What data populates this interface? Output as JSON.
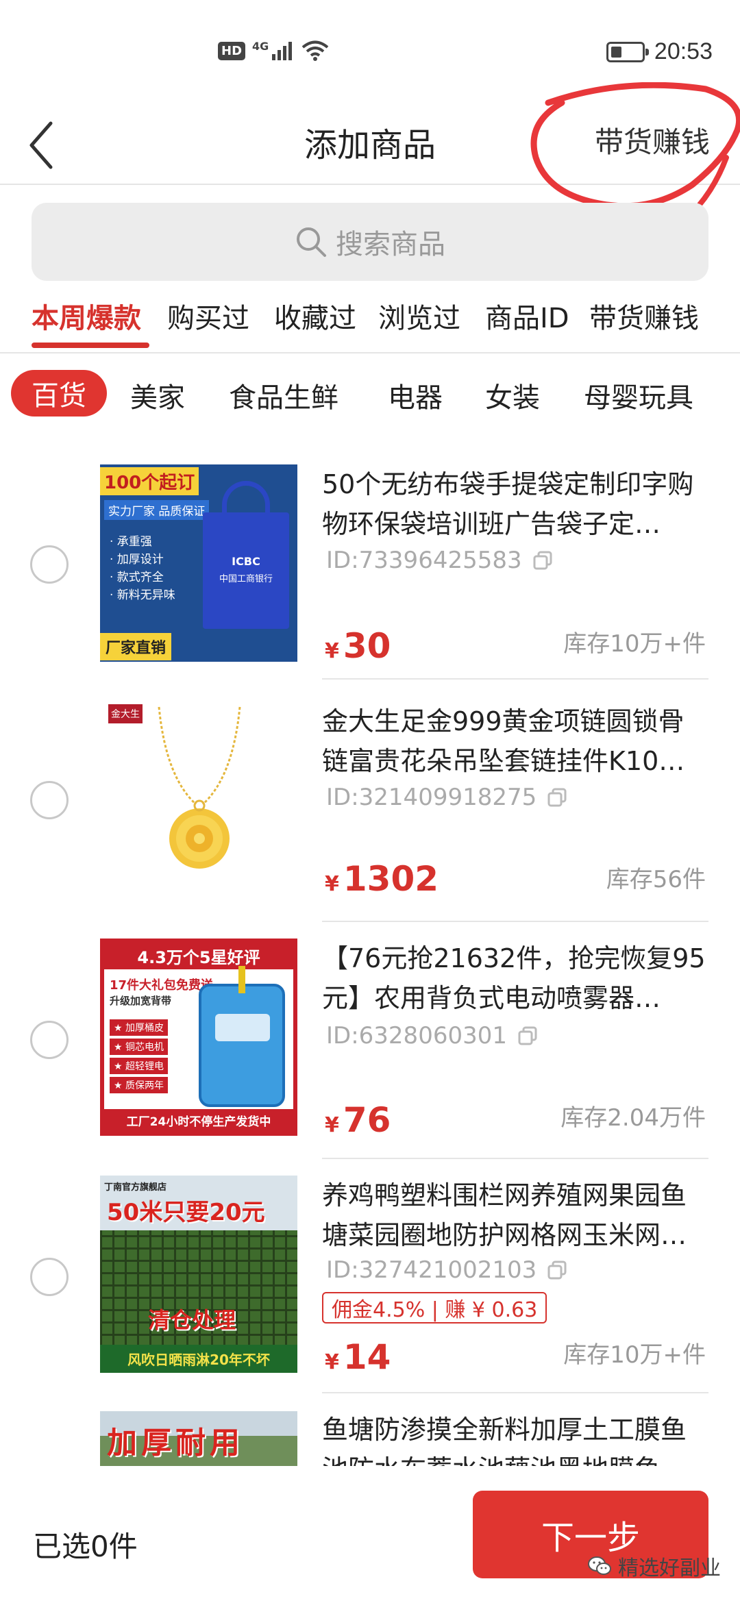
{
  "status_bar": {
    "hd": "HD",
    "network": "4G",
    "time": "20:53",
    "battery_level_percent": 35
  },
  "header": {
    "title": "添加商品",
    "right_link": "带货赚钱"
  },
  "search": {
    "placeholder": "搜索商品"
  },
  "tabs": [
    "本周爆款",
    "购买过",
    "收藏过",
    "浏览过",
    "商品ID",
    "带货赚钱"
  ],
  "active_tab": "本周爆款",
  "categories": [
    "百货",
    "美家",
    "食品生鲜",
    "电器",
    "女装",
    "母婴玩具"
  ],
  "active_category": "百货",
  "currency": "¥",
  "products": [
    {
      "title": "50个无纺布袋手提袋定制印字购物环保袋培训班广告袋子定…",
      "id_text": "ID:73396425583",
      "price": "30",
      "stock": "库存10万+件",
      "thumb": {
        "banner": "100个起订",
        "sub": "实力厂家 品质保证",
        "features": [
          "· 承重强",
          "· 加厚设计",
          "· 款式齐全",
          "· 新料无异味"
        ],
        "bag_brand": "ICBC",
        "bag_text": "中国工商银行",
        "footer": "厂家直销"
      }
    },
    {
      "title": "金大生足金999黄金项链圆锁骨链富贵花朵吊坠套链挂件K10…",
      "id_text": "ID:321409918275",
      "price": "1302",
      "stock": "库存56件",
      "thumb": {
        "logo": "金大生"
      }
    },
    {
      "title": "【76元抢21632件，抢完恢复95元】农用背负式电动喷雾器…",
      "id_text": "ID:6328060301",
      "price": "76",
      "stock": "库存2.04万件",
      "thumb": {
        "banner": "4.3万个5星好评",
        "gift": "17件大礼包免费送",
        "sub": "升级加宽背带",
        "features": [
          "★ 加厚桶皮",
          "★ 铜芯电机",
          "★ 超轻锂电",
          "★ 质保两年"
        ],
        "footer": "工厂24小时不停生产发货中"
      }
    },
    {
      "title": "养鸡鸭塑料围栏网养殖网果园鱼塘菜园圈地防护网格网玉米网…",
      "id_text": "ID:327421002103",
      "commission": "佣金4.5% | 赚 ¥ 0.63",
      "price": "14",
      "stock": "库存10万+件",
      "thumb": {
        "store": "丁南官方旗舰店",
        "banner": "50米只要20元",
        "mid": "清仓处理",
        "footer": "风吹日晒雨淋20年不坏"
      }
    },
    {
      "title": "鱼塘防渗摸全新料加厚土工膜鱼池防水布蓄水池藕池黑地膜鱼…",
      "thumb": {
        "banner": "加厚耐用"
      }
    }
  ],
  "bottom": {
    "selected": "已选0件",
    "next": "下一步"
  },
  "watermark": "精选好副业",
  "colors": {
    "accent": "#e03530",
    "annotation": "#e8373a",
    "muted": "#999999"
  }
}
